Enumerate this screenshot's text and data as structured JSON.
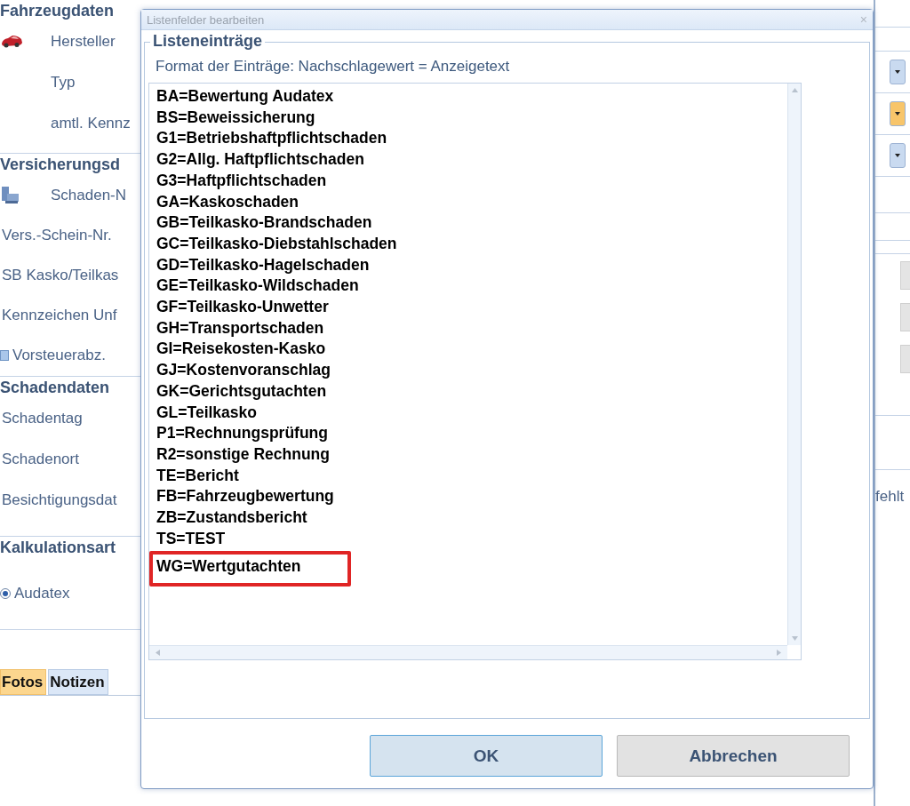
{
  "background_form": {
    "sections": [
      {
        "title": "Fahrzeugdaten",
        "fields": [
          {
            "kind": "car",
            "label": "Hersteller"
          },
          {
            "kind": "plain",
            "label": "Typ"
          },
          {
            "kind": "plain",
            "label": "amtl. Kennz"
          }
        ]
      },
      {
        "title": "Versicherungsd",
        "fields": [
          {
            "kind": "computer",
            "label": "Schaden-N"
          },
          {
            "kind": "plain",
            "label": "Vers.-Schein-Nr."
          },
          {
            "kind": "plain",
            "label": "SB Kasko/Teilkas"
          },
          {
            "kind": "plain",
            "label": "Kennzeichen Unf"
          },
          {
            "kind": "checkbox",
            "label": "Vorsteuerabz.",
            "checked": false
          }
        ]
      },
      {
        "title": "Schadendaten",
        "fields": [
          {
            "kind": "plain",
            "label": "Schadentag"
          },
          {
            "kind": "plain",
            "label": "Schadenort"
          },
          {
            "kind": "plain",
            "label": "Besichtigungsdat"
          }
        ]
      },
      {
        "title": "Kalkulationsart",
        "fields": [
          {
            "kind": "radio",
            "label": "Audatex",
            "selected": true
          }
        ]
      }
    ],
    "tabs": [
      {
        "label": "Fotos",
        "selected": true
      },
      {
        "label": "Notizen",
        "selected": false
      }
    ],
    "right_edge": {
      "dropdowns": [
        {
          "color": "#c9daf0"
        },
        {
          "color": "#f8c56a"
        },
        {
          "color": "#c9daf0"
        }
      ],
      "note": "fehlt"
    }
  },
  "dialog": {
    "title": "Listenfelder bearbeiten",
    "close": "×",
    "group_title": "Listeneinträge",
    "hint": "Format der Einträge: Nachschlagewert = Anzeigetext",
    "entries": [
      {
        "text": "BA=Bewertung Audatex",
        "marked": false
      },
      {
        "text": "BS=Beweissicherung",
        "marked": false
      },
      {
        "text": "G1=Betriebshaftpflichtschaden",
        "marked": false
      },
      {
        "text": "G2=Allg. Haftpflichtschaden",
        "marked": false
      },
      {
        "text": "G3=Haftpflichtschaden",
        "marked": false
      },
      {
        "text": "GA=Kaskoschaden",
        "marked": false
      },
      {
        "text": "GB=Teilkasko-Brandschaden",
        "marked": false
      },
      {
        "text": "GC=Teilkasko-Diebstahlschaden",
        "marked": false
      },
      {
        "text": "GD=Teilkasko-Hagelschaden",
        "marked": false
      },
      {
        "text": "GE=Teilkasko-Wildschaden",
        "marked": false
      },
      {
        "text": "GF=Teilkasko-Unwetter",
        "marked": false
      },
      {
        "text": "GH=Transportschaden",
        "marked": false
      },
      {
        "text": "GI=Reisekosten-Kasko",
        "marked": false
      },
      {
        "text": "GJ=Kostenvoranschlag",
        "marked": false
      },
      {
        "text": "GK=Gerichtsgutachten",
        "marked": false
      },
      {
        "text": "GL=Teilkasko",
        "marked": false
      },
      {
        "text": "P1=Rechnungsprüfung",
        "marked": false
      },
      {
        "text": "R2=sonstige Rechnung",
        "marked": false
      },
      {
        "text": "TE=Bericht",
        "marked": false
      },
      {
        "text": "FB=Fahrzeugbewertung",
        "marked": false
      },
      {
        "text": "ZB=Zustandsbericht",
        "marked": false
      },
      {
        "text": "TS=TEST",
        "marked": false
      },
      {
        "text": "WG=Wertgutachten",
        "marked": true
      }
    ],
    "buttons": [
      {
        "label": "OK",
        "default": true
      },
      {
        "label": "Abbrechen",
        "default": false
      }
    ]
  }
}
